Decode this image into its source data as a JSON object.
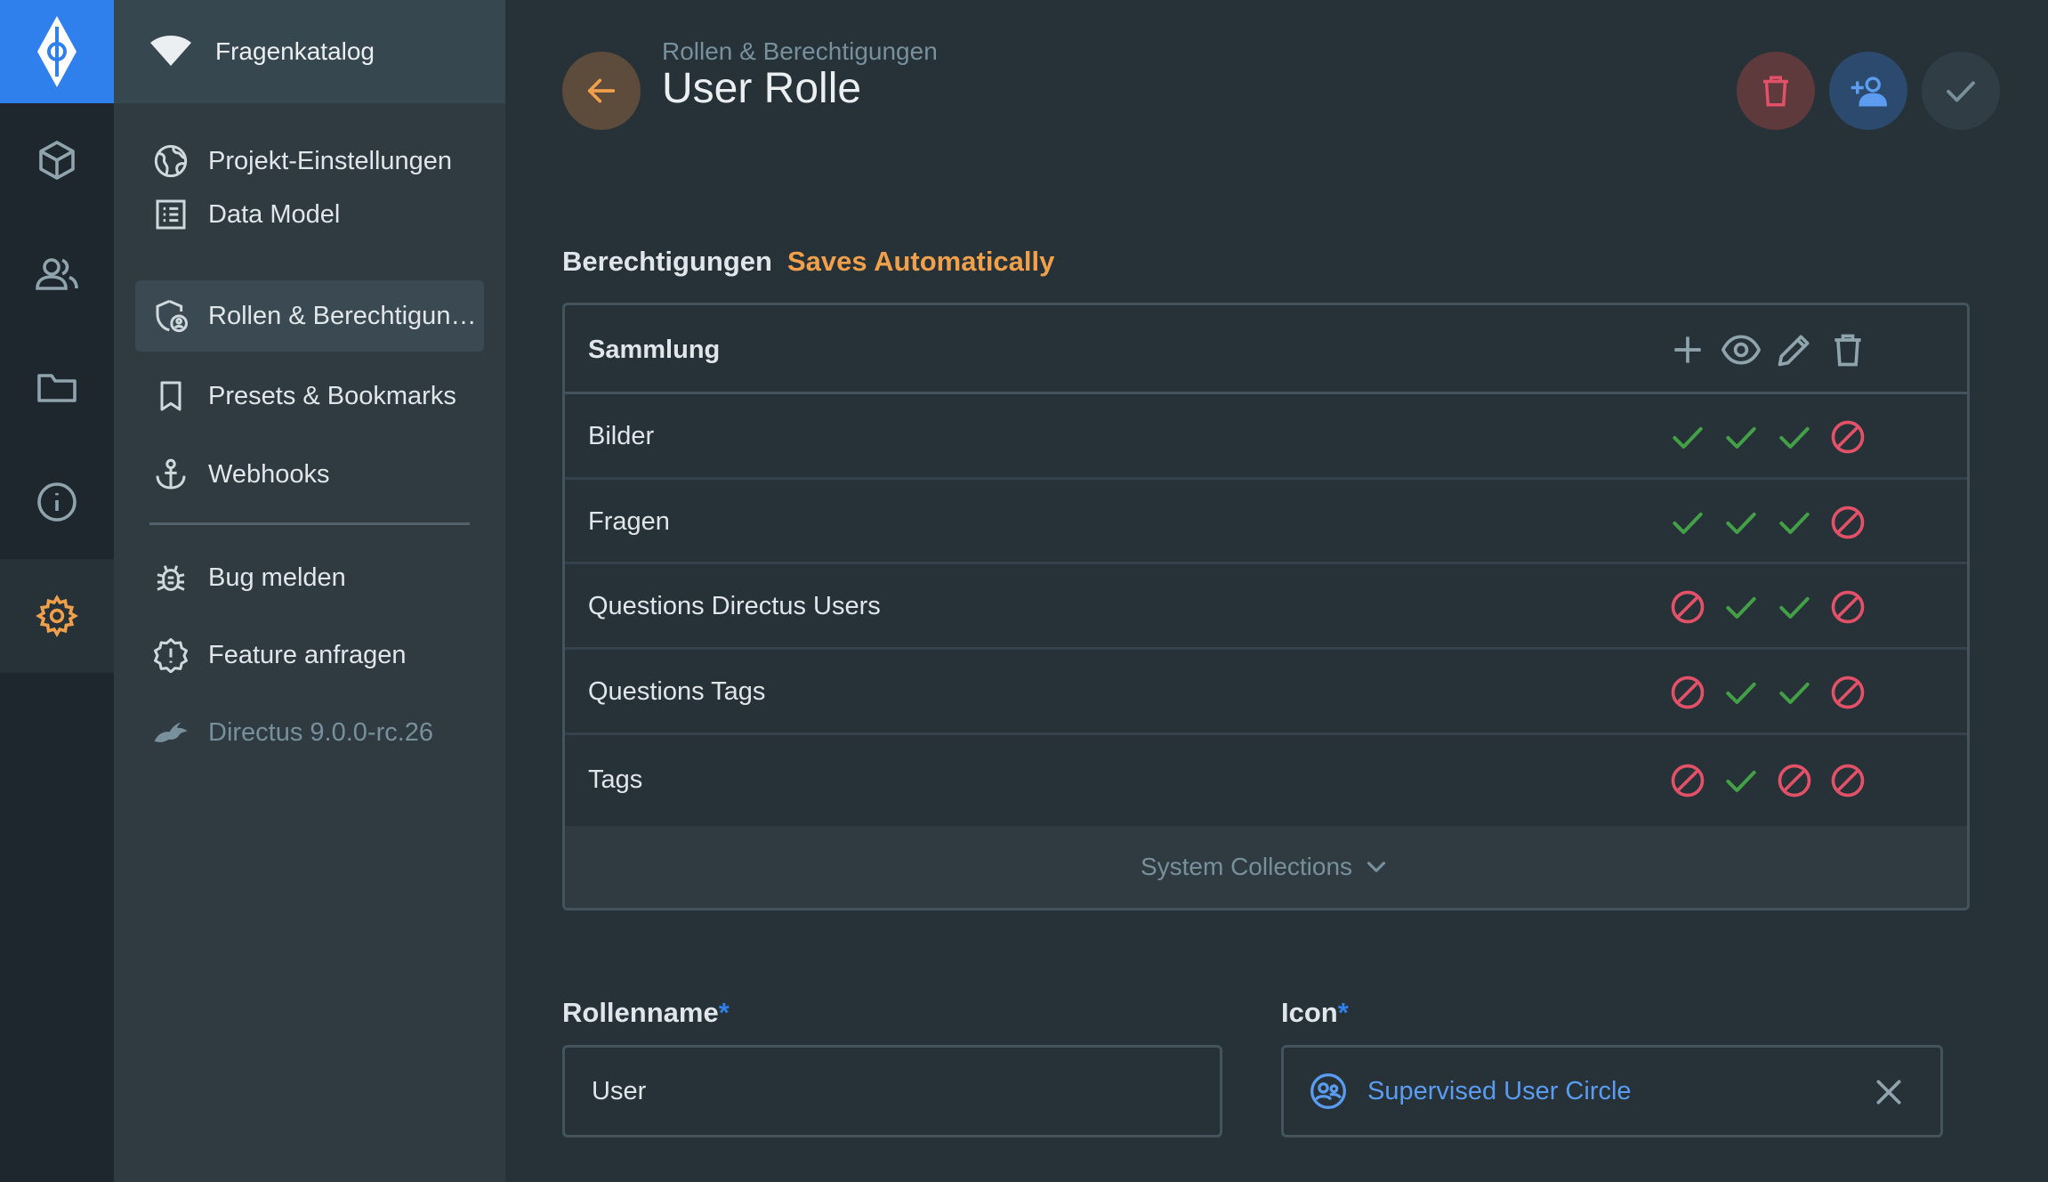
{
  "module_bar": {
    "logo_icon": "directus-logo-icon",
    "items": [
      {
        "name": "content",
        "icon": "box-icon"
      },
      {
        "name": "users",
        "icon": "users-icon"
      },
      {
        "name": "files",
        "icon": "folder-icon"
      },
      {
        "name": "info",
        "icon": "info-icon"
      },
      {
        "name": "settings",
        "icon": "gear-icon",
        "active": true
      }
    ]
  },
  "nav": {
    "project_name": "Fragenkatalog",
    "items": [
      {
        "label": "Projekt-Einstellungen",
        "icon": "globe-icon"
      },
      {
        "label": "Data Model",
        "icon": "list-icon"
      },
      {
        "label": "Rollen & Berechtigungen",
        "icon": "shield-icon",
        "active": true
      },
      {
        "label": "Presets & Bookmarks",
        "icon": "bookmark-icon"
      },
      {
        "label": "Webhooks",
        "icon": "anchor-icon"
      },
      {
        "label": "Bug melden",
        "icon": "bug-icon"
      },
      {
        "label": "Feature anfragen",
        "icon": "new-releases-icon"
      },
      {
        "label": "Directus 9.0.0-rc.26",
        "icon": "rabbit-icon",
        "muted": true
      }
    ]
  },
  "header": {
    "breadcrumb": "Rollen & Berechtigungen",
    "title": "User Rolle",
    "actions": [
      "delete-icon",
      "invite-user-icon",
      "check-icon"
    ]
  },
  "permissions": {
    "section_title": "Berechtigungen",
    "section_note": "Saves Automatically",
    "column_header": "Sammlung",
    "action_icons": [
      "plus-icon",
      "eye-icon",
      "pencil-icon",
      "trash-icon"
    ],
    "rows": [
      {
        "name": "Bilder",
        "create": "all",
        "read": "all",
        "update": "all",
        "delete": "none"
      },
      {
        "name": "Fragen",
        "create": "all",
        "read": "all",
        "update": "all",
        "delete": "none"
      },
      {
        "name": "Questions Directus Users",
        "create": "none",
        "read": "all",
        "update": "all",
        "delete": "none"
      },
      {
        "name": "Questions Tags",
        "create": "none",
        "read": "all",
        "update": "all",
        "delete": "none"
      },
      {
        "name": "Tags",
        "create": "none",
        "read": "all",
        "update": "none",
        "delete": "none"
      }
    ],
    "system_collections_label": "System Collections"
  },
  "form": {
    "role_name_label": "Rollenname",
    "role_name_value": "User",
    "icon_label": "Icon",
    "icon_value": "Supervised User Circle",
    "required_marker": "*"
  },
  "colors": {
    "accent": "#2f80ed",
    "warning": "#f0a04b",
    "success": "#43a047",
    "danger": "#e35169"
  }
}
